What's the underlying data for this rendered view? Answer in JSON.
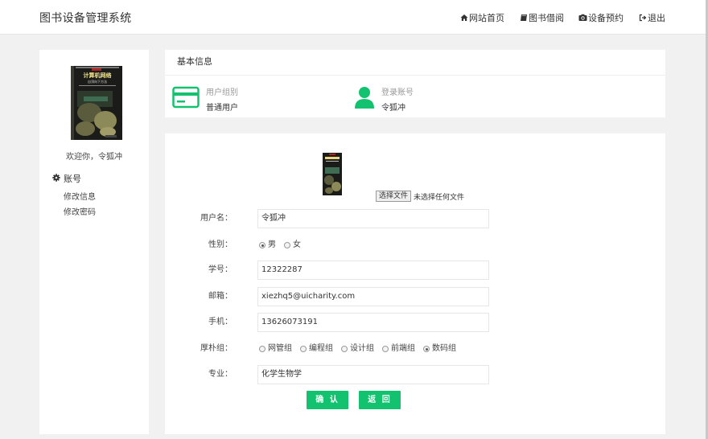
{
  "header": {
    "title": "图书设备管理系统",
    "nav": [
      {
        "label": "网站首页",
        "icon": "home-icon"
      },
      {
        "label": "图书借阅",
        "icon": "book-icon"
      },
      {
        "label": "设备预约",
        "icon": "camera-icon"
      },
      {
        "label": "退出",
        "icon": "sign-out-icon"
      }
    ]
  },
  "sidebar": {
    "avatar_book": {
      "title": "计算机网络",
      "subtitle": "自顶向下方法"
    },
    "welcome": "欢迎你，令狐冲",
    "section": "账号",
    "links": [
      "修改信息",
      "修改密码"
    ]
  },
  "basic_info": {
    "heading": "基本信息",
    "group_label": "用户组别",
    "group_value": "普通用户",
    "account_label": "登录账号",
    "account_value": "令狐冲"
  },
  "form": {
    "file_button": "选择文件",
    "file_status": "未选择任何文件",
    "username_label": "用户名：",
    "username": "令狐冲",
    "gender_label": "性别：",
    "gender_options": [
      "男",
      "女"
    ],
    "gender_selected": "男",
    "student_id_label": "学号：",
    "student_id": "12322287",
    "email_label": "邮箱：",
    "email": "xiezhq5@uicharity.com",
    "phone_label": "手机：",
    "phone": "13626073191",
    "group_label": "厚朴组：",
    "group_options": [
      "网管组",
      "编程组",
      "设计组",
      "前端组",
      "数码组"
    ],
    "group_selected": "数码组",
    "major_label": "专业：",
    "major": "化学生物学",
    "confirm": "确 认",
    "back": "返 回"
  },
  "colors": {
    "accent": "#13c26f"
  }
}
